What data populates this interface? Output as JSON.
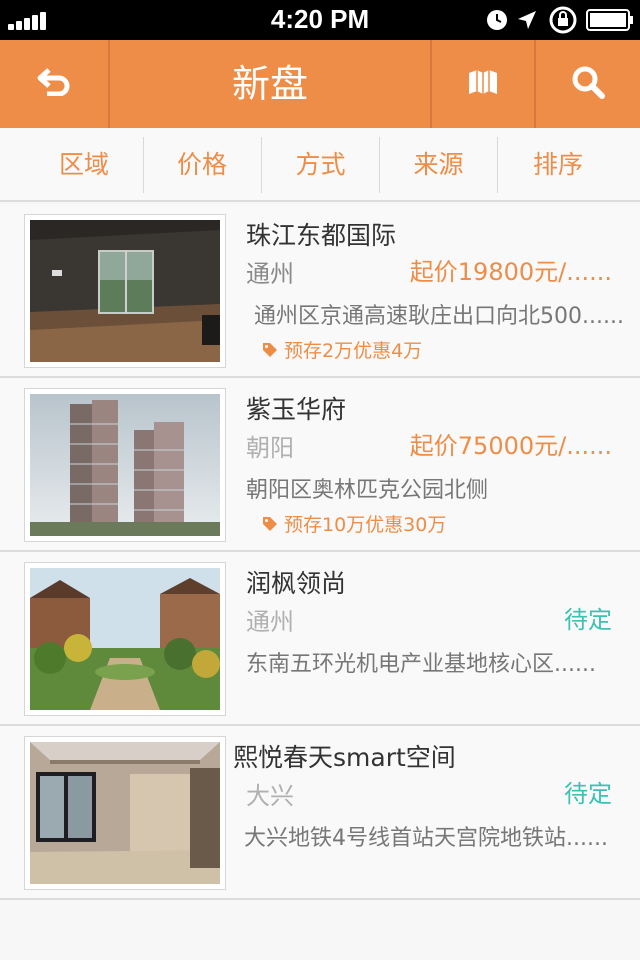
{
  "status_bar": {
    "time": "4:20 PM",
    "icons": [
      "signal-icon",
      "clock-icon",
      "location-arrow-icon",
      "rotation-lock-icon",
      "battery-icon"
    ]
  },
  "header": {
    "title": "新盘",
    "back_icon": "back-arrow-icon",
    "map_icon": "map-icon",
    "search_icon": "search-icon",
    "background_color": "#ee8d47"
  },
  "filters": [
    {
      "label": "区域"
    },
    {
      "label": "价格"
    },
    {
      "label": "方式"
    },
    {
      "label": "来源"
    },
    {
      "label": "排序"
    }
  ],
  "listings": [
    {
      "name": "珠江东都国际",
      "region": "通州",
      "price": "起价19800元/......",
      "address": "通州区京通高速耿庄出口向北500......",
      "promo": "预存2万优惠4万",
      "image": "empty-apartment-interior-photo"
    },
    {
      "name": "紫玉华府",
      "region": "朝阳",
      "price": "起价75000元/......",
      "address": "朝阳区奥林匹克公园北侧",
      "promo": "预存10万优惠30万",
      "image": "high-rise-towers-rendering"
    },
    {
      "name": "润枫领尚",
      "region": "通州",
      "price": "待定",
      "address": "东南五环光机电产业基地核心区......",
      "image": "garden-villa-rendering"
    },
    {
      "name": "熙悦春天smart空间",
      "region": "大兴",
      "price": "待定",
      "address": "大兴地铁4号线首站天宫院地铁站......",
      "image": "living-room-interior-photo"
    }
  ],
  "colors": {
    "accent": "#ee8d47",
    "tbd": "#3cc2b3"
  }
}
